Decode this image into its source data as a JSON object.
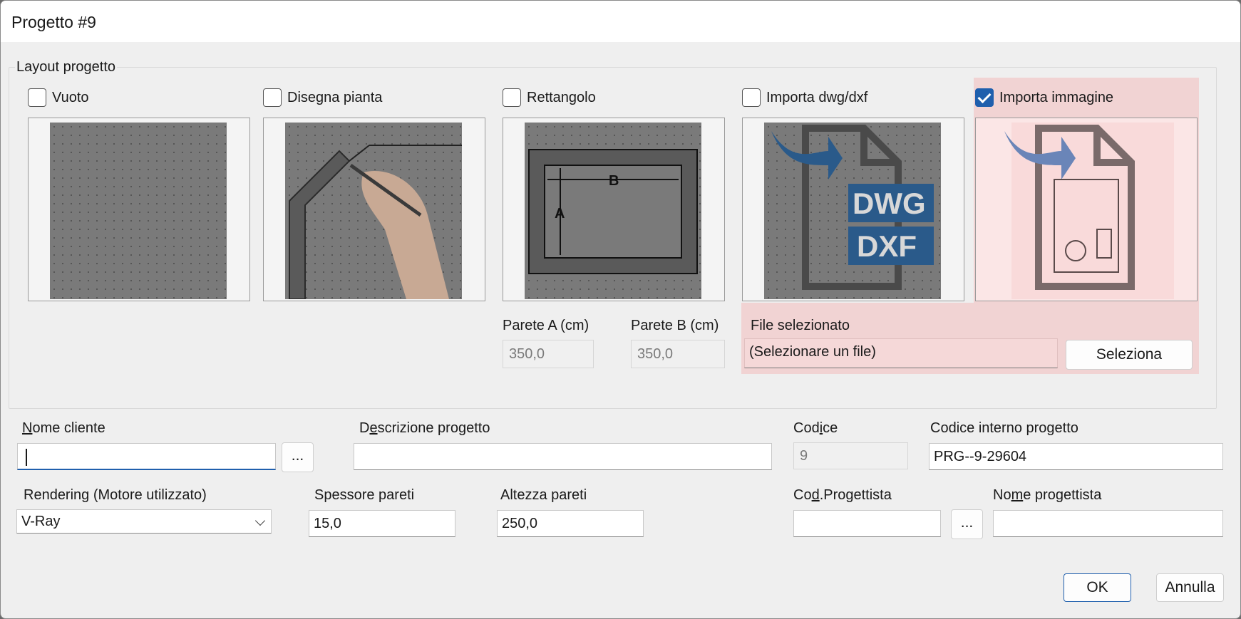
{
  "window": {
    "title": "Progetto #9"
  },
  "layout_group": {
    "title": "Layout progetto",
    "options": [
      {
        "label": "Vuoto",
        "checked": false
      },
      {
        "label": "Disegna pianta",
        "checked": false
      },
      {
        "label": "Rettangolo",
        "checked": false
      },
      {
        "label": "Importa dwg/dxf",
        "checked": false
      },
      {
        "label": "Importa immagine",
        "checked": true
      }
    ],
    "rect_labels": {
      "a": "A",
      "b": "B"
    },
    "dwg_labels": {
      "dwg": "DWG",
      "dxf": "DXF"
    },
    "wall_a": {
      "label": "Parete A (cm)",
      "value": "350,0"
    },
    "wall_b": {
      "label": "Parete B (cm)",
      "value": "350,0"
    },
    "file": {
      "label": "File selezionato",
      "value": "(Selezionare un file)",
      "button": "Seleziona"
    }
  },
  "form": {
    "cliente": {
      "label_accel": "N",
      "label_rest": "ome cliente",
      "value": "",
      "browse": "..."
    },
    "descrizione": {
      "label_pre": "D",
      "label_accel": "e",
      "label_rest": "scrizione progetto",
      "value": ""
    },
    "codice": {
      "label_pre": "Cod",
      "label_accel": "i",
      "label_rest": "ce",
      "value": "9"
    },
    "codice_interno": {
      "label": "Codice interno progetto",
      "value": "PRG--9-29604"
    },
    "rendering": {
      "label": "Rendering (Motore utilizzato)",
      "value": "V-Ray"
    },
    "spessore": {
      "label": "Spessore pareti",
      "value": "15,0"
    },
    "altezza": {
      "label": "Altezza pareti",
      "value": "250,0"
    },
    "cod_progettista": {
      "label_pre": "Co",
      "label_accel": "d",
      "label_rest": ".Progettista",
      "value": "",
      "browse": "..."
    },
    "nome_progettista": {
      "label_pre": "No",
      "label_accel": "m",
      "label_rest": "e progettista",
      "value": ""
    }
  },
  "buttons": {
    "ok": "OK",
    "cancel": "Annulla"
  },
  "colors": {
    "accent": "#1f5fad",
    "highlight": "#f1d3d3",
    "preview_gray": "#7a7a7a"
  }
}
